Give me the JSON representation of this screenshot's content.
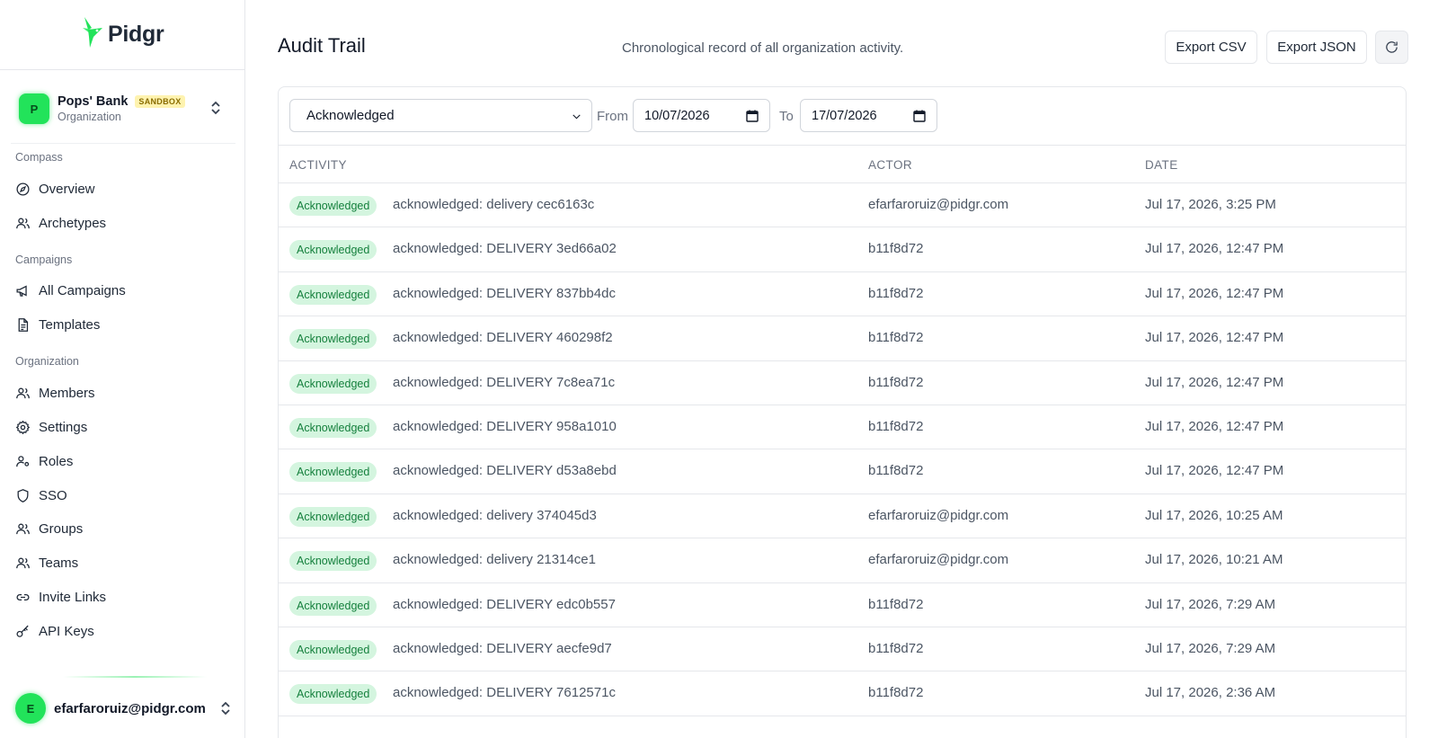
{
  "app": {
    "name": "Pidgr"
  },
  "org": {
    "avatar": "P",
    "name": "Pops' Bank",
    "badge": "SANDBOX",
    "sub": "Organization"
  },
  "nav": {
    "compass": "Compass",
    "overview": "Overview",
    "archetypes": "Archetypes",
    "campaigns": "Campaigns",
    "all_campaigns": "All Campaigns",
    "templates": "Templates",
    "organization": "Organization",
    "members": "Members",
    "settings": "Settings",
    "roles": "Roles",
    "sso": "SSO",
    "groups": "Groups",
    "teams": "Teams",
    "invite_links": "Invite Links",
    "api_keys": "API Keys"
  },
  "user": {
    "avatar": "E",
    "email": "efarfaroruiz@pidgr.com"
  },
  "page": {
    "title": "Audit Trail",
    "subtitle": "Chronological record of all organization activity.",
    "export_csv": "Export CSV",
    "export_json": "Export JSON"
  },
  "filters": {
    "event_type": "Acknowledged",
    "from_label": "From",
    "from_value": "10/07/2026",
    "to_label": "To",
    "to_value": "17/07/2026"
  },
  "table": {
    "headers": {
      "activity": "ACTIVITY",
      "actor": "ACTOR",
      "date": "DATE"
    },
    "rows": [
      {
        "badge": "Acknowledged",
        "activity": "acknowledged: delivery cec6163c",
        "actor": "efarfaroruiz@pidgr.com",
        "date": "Jul 17, 2026, 3:25 PM"
      },
      {
        "badge": "Acknowledged",
        "activity": "acknowledged: DELIVERY 3ed66a02",
        "actor": "b11f8d72",
        "date": "Jul 17, 2026, 12:47 PM"
      },
      {
        "badge": "Acknowledged",
        "activity": "acknowledged: DELIVERY 837bb4dc",
        "actor": "b11f8d72",
        "date": "Jul 17, 2026, 12:47 PM"
      },
      {
        "badge": "Acknowledged",
        "activity": "acknowledged: DELIVERY 460298f2",
        "actor": "b11f8d72",
        "date": "Jul 17, 2026, 12:47 PM"
      },
      {
        "badge": "Acknowledged",
        "activity": "acknowledged: DELIVERY 7c8ea71c",
        "actor": "b11f8d72",
        "date": "Jul 17, 2026, 12:47 PM"
      },
      {
        "badge": "Acknowledged",
        "activity": "acknowledged: DELIVERY 958a1010",
        "actor": "b11f8d72",
        "date": "Jul 17, 2026, 12:47 PM"
      },
      {
        "badge": "Acknowledged",
        "activity": "acknowledged: DELIVERY d53a8ebd",
        "actor": "b11f8d72",
        "date": "Jul 17, 2026, 12:47 PM"
      },
      {
        "badge": "Acknowledged",
        "activity": "acknowledged: delivery 374045d3",
        "actor": "efarfaroruiz@pidgr.com",
        "date": "Jul 17, 2026, 10:25 AM"
      },
      {
        "badge": "Acknowledged",
        "activity": "acknowledged: delivery 21314ce1",
        "actor": "efarfaroruiz@pidgr.com",
        "date": "Jul 17, 2026, 10:21 AM"
      },
      {
        "badge": "Acknowledged",
        "activity": "acknowledged: DELIVERY edc0b557",
        "actor": "b11f8d72",
        "date": "Jul 17, 2026, 7:29 AM"
      },
      {
        "badge": "Acknowledged",
        "activity": "acknowledged: DELIVERY aecfe9d7",
        "actor": "b11f8d72",
        "date": "Jul 17, 2026, 7:29 AM"
      },
      {
        "badge": "Acknowledged",
        "activity": "acknowledged: DELIVERY 7612571c",
        "actor": "b11f8d72",
        "date": "Jul 17, 2026, 2:36 AM"
      }
    ]
  },
  "colors": {
    "brand": "#22e35a",
    "badge_bg": "#d4f5df",
    "badge_text": "#15803d"
  },
  "icons": [
    "pidgr-logo-icon",
    "chevron-updown-icon",
    "compass-icon",
    "users-icon",
    "megaphone-icon",
    "file-text-icon",
    "gear-icon",
    "user-key-icon",
    "shield-icon",
    "link-icon",
    "key-icon",
    "refresh-icon",
    "chevron-down-icon",
    "calendar-icon"
  ]
}
